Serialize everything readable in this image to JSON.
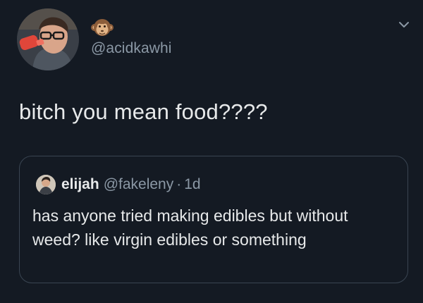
{
  "tweet": {
    "handle": "@acidkawhi",
    "name_emoji": "monkey-face",
    "text": "bitch you mean food????"
  },
  "quoted_tweet": {
    "name": "elijah",
    "handle": "@fakeleny",
    "separator": "·",
    "time": "1d",
    "text": "has anyone tried making edibles but without weed? like virgin edibles or something"
  },
  "colors": {
    "background": "#141a23",
    "primary_text": "#e7e9ea",
    "secondary_text": "#8b98a5",
    "border": "#3a4552"
  }
}
